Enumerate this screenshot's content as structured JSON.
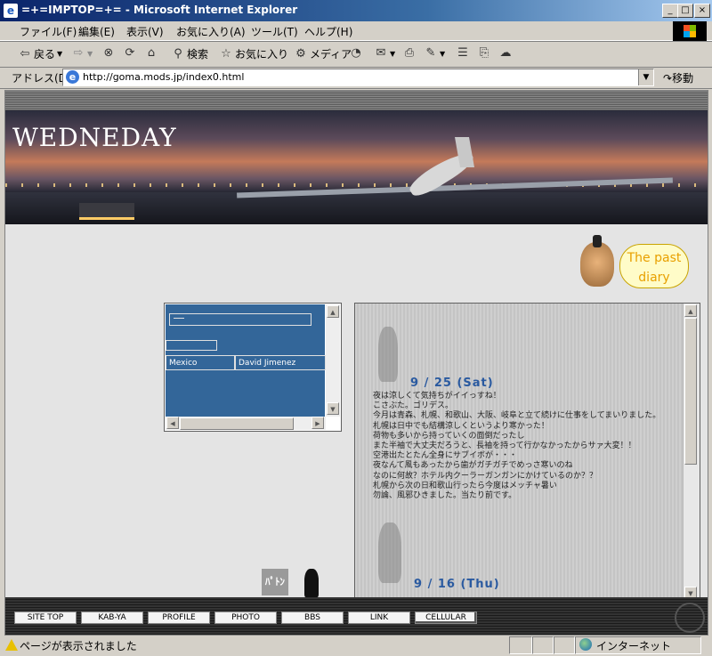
{
  "window": {
    "title": "=+=IMPTOP=+= - Microsoft Internet Explorer",
    "controls": [
      "_",
      "□",
      "×"
    ]
  },
  "menu": [
    "ファイル(F)",
    "編集(E)",
    "表示(V)",
    "お気に入り(A)",
    "ツール(T)",
    "ヘルプ(H)"
  ],
  "toolbar": {
    "back": "戻る",
    "search": "検索",
    "favorites": "お気に入り",
    "media": "メディア"
  },
  "address": {
    "label": "アドレス(D)",
    "url": "http://goma.mods.jp/index0.html",
    "go": "移動"
  },
  "page": {
    "banner_title": "WEDNEDAY",
    "past_diary_line1": "The past",
    "past_diary_line2": "diary",
    "link_table": {
      "cells": [
        "Mexico",
        "David Jimenez"
      ]
    },
    "diary": [
      {
        "date": "9 / 25 (Sat)",
        "lines": [
          "夜は涼しくて気持ちがイイっすね！",
          "こさぶた。ゴリデス。",
          "今月は青森、札幌、和歌山、大阪、岐阜と立て続けに仕事をしてまいりました。",
          "札幌は日中でも結構涼しくというより寒かった！",
          "荷物も多いから持っていくの面倒だったし",
          "また半袖で大丈夫だろうと、長袖を持って行かなかったからサァ大変！！",
          "空港出たとたん全身にサブイボが・・・",
          "夜なんて風もあったから歯がガチガチでめっさ寒いのね",
          "なのに何故？ホテル内クーラーガンガンにかけているのか？？",
          "札幌から次の日和歌山行ったら今度はメッチャ暑い",
          "勿論、風邪ひきました。当たり前です。"
        ]
      },
      {
        "date": "9 / 16 (Thu)",
        "lines": []
      }
    ],
    "bottom_logo": "ﾊﾟﾄﾝ",
    "nav": [
      "SITE TOP",
      "KAB-YA",
      "PROFILE",
      "PHOTO",
      "BBS",
      "LINK",
      "CELLULAR"
    ]
  },
  "status": {
    "message": "ページが表示されました",
    "zone": "インターネット"
  },
  "colors": {
    "titlebar": "#0a246a",
    "link_table_bg": "#336699",
    "diary_date": "#2a5aa0",
    "bubble_text": "#e8a000"
  }
}
